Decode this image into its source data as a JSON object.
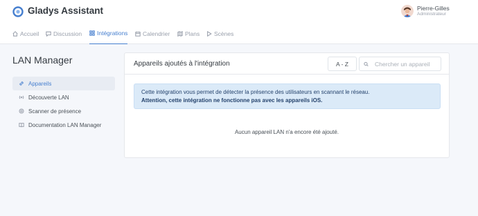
{
  "app": {
    "title": "Gladys Assistant"
  },
  "user": {
    "name": "Pierre-Gilles",
    "role": "Administrateur"
  },
  "nav": [
    {
      "label": "Accueil",
      "icon": "home-icon",
      "active": false
    },
    {
      "label": "Discussion",
      "icon": "message-icon",
      "active": false
    },
    {
      "label": "Intégrations",
      "icon": "grid-icon",
      "active": true
    },
    {
      "label": "Calendrier",
      "icon": "calendar-icon",
      "active": false
    },
    {
      "label": "Plans",
      "icon": "map-icon",
      "active": false
    },
    {
      "label": "Scènes",
      "icon": "play-icon",
      "active": false
    }
  ],
  "sidebar": {
    "title": "LAN Manager",
    "items": [
      {
        "label": "Appareils",
        "icon": "link-icon",
        "active": true
      },
      {
        "label": "Découverte LAN",
        "icon": "radio-icon",
        "active": false
      },
      {
        "label": "Scanner de présence",
        "icon": "settings-icon",
        "active": false
      },
      {
        "label": "Documentation LAN Manager",
        "icon": "book-icon",
        "active": false
      }
    ]
  },
  "main": {
    "title": "Appareils ajoutés à l'intégration",
    "sort_label": "A - Z",
    "search_placeholder": "Chercher un appareil",
    "alert": {
      "text": "Cette intégration vous permet de détecter la présence des utilisateurs en scannant le réseau.",
      "strong": "Attention, cette intégration ne fonctionne pas avec les appareils iOS."
    },
    "empty_text": "Aucun appareil LAN n'a encore été ajouté."
  },
  "colors": {
    "accent": "#467fcf",
    "background": "#f5f7fb",
    "alert_bg": "#dbeaf8"
  }
}
